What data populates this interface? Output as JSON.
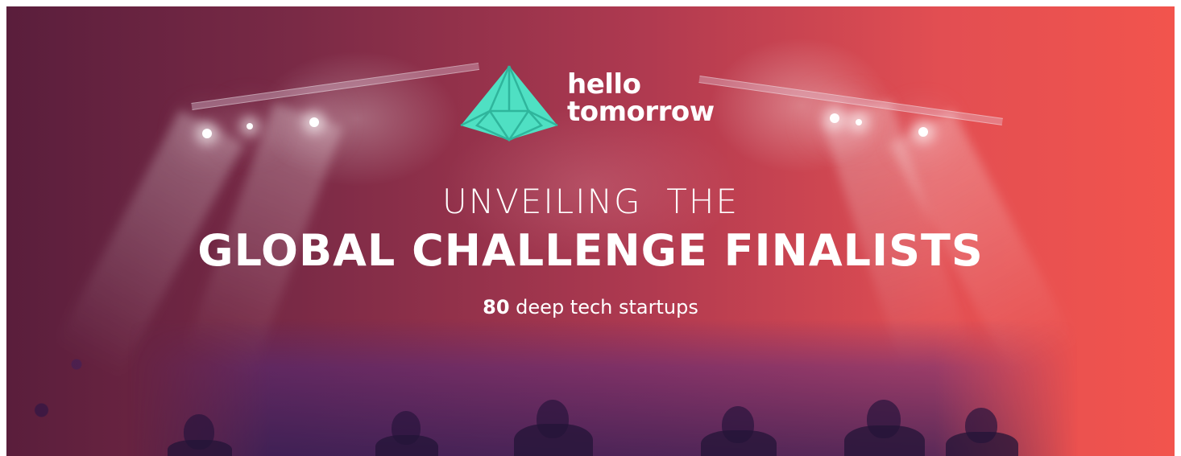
{
  "banner": {
    "logo": {
      "line1": "hello",
      "line2": "tomorrow",
      "icon": "diamond-icon",
      "icon_color": "#4fe0c3"
    },
    "headline_line1": "UNVEILING  THE",
    "headline_line2": "GLOBAL CHALLENGE FINALISTS",
    "subline_count": "80",
    "subline_text": "deep tech startups",
    "colors": {
      "gradient_start": "#5a1e3c",
      "gradient_end": "#f2544d",
      "text": "#ffffff"
    }
  }
}
